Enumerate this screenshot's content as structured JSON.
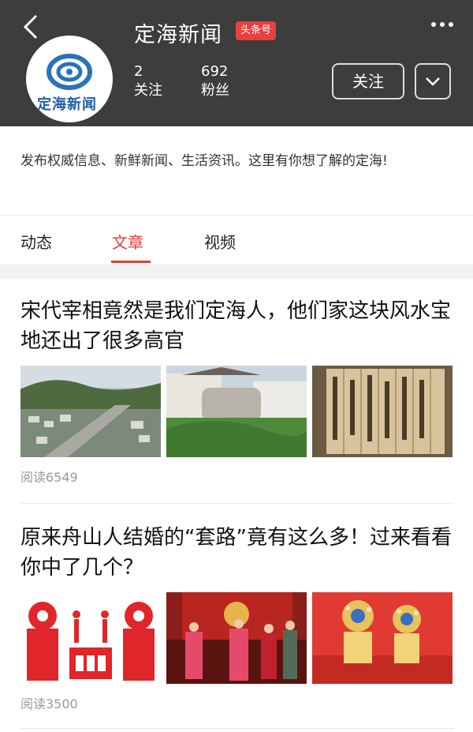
{
  "header": {
    "title": "定海新闻",
    "badge": "头条号",
    "avatar_text": "定海新闻",
    "stats": [
      {
        "value": "2",
        "label": "关注"
      },
      {
        "value": "692",
        "label": "粉丝"
      }
    ],
    "follow_label": "关注"
  },
  "description": "发布权威信息、新鲜新闻、生活资讯。这里有你想了解的定海!",
  "tabs": [
    {
      "label": "动态",
      "active": false
    },
    {
      "label": "文章",
      "active": true
    },
    {
      "label": "视频",
      "active": false
    }
  ],
  "articles": [
    {
      "title": "宋代宰相竟然是我们定海人，他们家这块风水宝地还出了很多高官",
      "reads": "阅读6549"
    },
    {
      "title": "原来舟山人结婚的“套路”竟有这么多！过来看看你中了几个？",
      "reads": "阅读3500"
    }
  ],
  "colors": {
    "accent": "#e13e3b",
    "header_bg": "#3d3d3d"
  }
}
